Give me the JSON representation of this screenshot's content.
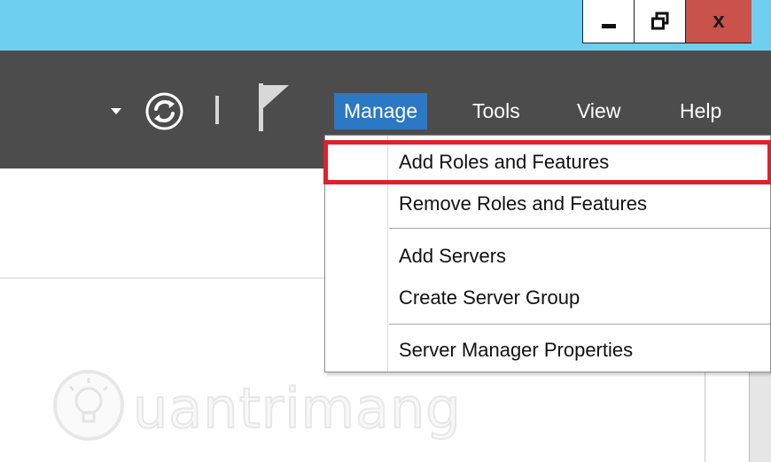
{
  "window": {
    "controls": {
      "minimize_icon": "minimize-icon",
      "restore_icon": "restore-icon",
      "close_label": "x"
    }
  },
  "toolbar": {
    "refresh_icon": "refresh-icon",
    "flag_icon": "flag-icon",
    "menu": [
      {
        "label": "Manage",
        "active": true
      },
      {
        "label": "Tools"
      },
      {
        "label": "View"
      },
      {
        "label": "Help"
      }
    ]
  },
  "manage_menu": {
    "items": [
      {
        "label": "Add Roles and Features",
        "highlighted": true
      },
      {
        "label": "Remove Roles and Features"
      },
      {
        "label": "Add Servers"
      },
      {
        "label": "Create Server Group"
      },
      {
        "label": "Server Manager Properties"
      }
    ]
  },
  "watermark": {
    "text": "uantrimang",
    "icon": "lightbulb-icon"
  },
  "colors": {
    "titlebar": "#6fcff0",
    "toolbar": "#4c4c4c",
    "menu_active": "#2b78c4",
    "close_button": "#c9524a",
    "highlight": "#e0202f"
  }
}
